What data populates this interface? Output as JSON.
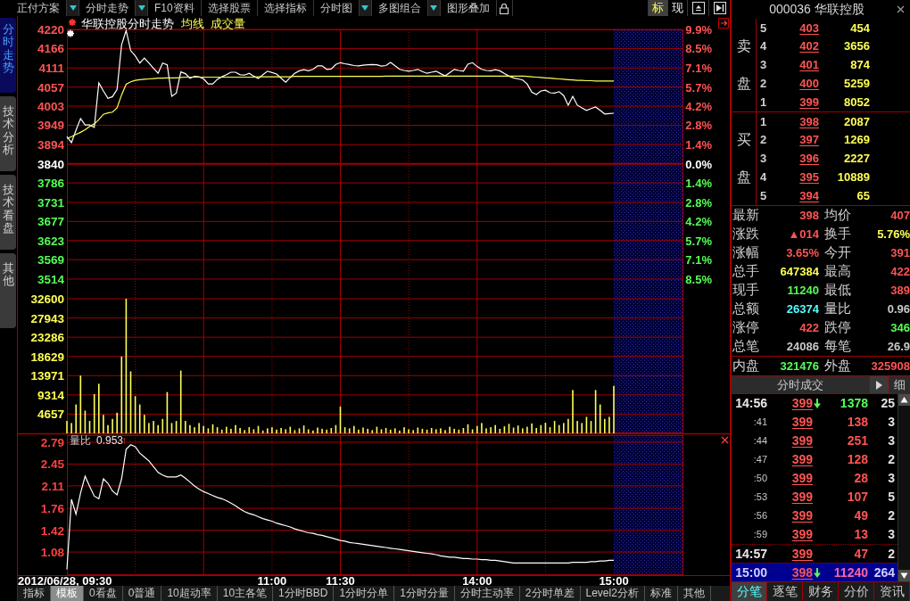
{
  "toolbar": {
    "menus": [
      {
        "label": "正付方案",
        "dropdown": true
      },
      {
        "label": "分时走势",
        "dropdown": true
      },
      {
        "label": "F10资料",
        "dropdown": false
      },
      {
        "label": "选择股票",
        "dropdown": false
      },
      {
        "label": "选择指标",
        "dropdown": false
      },
      {
        "label": "分时图",
        "dropdown": true
      },
      {
        "label": "多图组合",
        "dropdown": true
      },
      {
        "label": "图形叠加",
        "dropdown": false
      }
    ],
    "view_tabs": [
      {
        "label": "标",
        "selected": true
      },
      {
        "label": "现",
        "selected": false
      }
    ]
  },
  "side_tabs": [
    {
      "label": "分时走势",
      "selected": true
    },
    {
      "label": "技术分析",
      "selected": false
    },
    {
      "label": "技术看盘",
      "selected": false
    },
    {
      "label": "其他",
      "selected": false
    }
  ],
  "chart": {
    "price_panel": {
      "chart_data": {
        "type": "line",
        "title": "华联控股分时走势",
        "categories": [
          null,
          null,
          null,
          null,
          null,
          null,
          null,
          null,
          null,
          null,
          null,
          null,
          null,
          null,
          null,
          null,
          null,
          null,
          null,
          null,
          null,
          null,
          null,
          null,
          null,
          null,
          null,
          null,
          null,
          null,
          null,
          null,
          null,
          null,
          null,
          null,
          null,
          null,
          null,
          null,
          null,
          null,
          null,
          null,
          null,
          null,
          null,
          null,
          null,
          null,
          null,
          null,
          null,
          null,
          null,
          null,
          null,
          null,
          null,
          null,
          null,
          null,
          null,
          null,
          null,
          null,
          null,
          null,
          null,
          null,
          null,
          null,
          null,
          null,
          null,
          null,
          null,
          null,
          null,
          null,
          null,
          null,
          null,
          null,
          null,
          null,
          null,
          null,
          null,
          null,
          null,
          null,
          null,
          null,
          null,
          null,
          null,
          null,
          null,
          null,
          null,
          null,
          null,
          null,
          null,
          null,
          null,
          null,
          null,
          null,
          null,
          null,
          null,
          null,
          null,
          null,
          null,
          null,
          null,
          null,
          null
        ],
        "series": [
          {
            "color": "#ffffff",
            "values": [
              3917,
              3900,
              3935,
              3968,
              3950,
              3950,
              3943,
              4069,
              4046,
              4025,
              4030,
              4050,
              4177,
              4217,
              4160,
              4145,
              4125,
              4139,
              4125,
              4110,
              4096,
              4125,
              4120,
              4031,
              4040,
              4100,
              4095,
              4082,
              4087,
              4086,
              4080,
              4066,
              4066,
              4079,
              4086,
              4092,
              4099,
              4099,
              4092,
              4091,
              4096,
              4088,
              4081,
              4092,
              4102,
              4098,
              4094,
              4082,
              4071,
              4084,
              4096,
              4103,
              4106,
              4103,
              4107,
              4117,
              4117,
              4107,
              4108,
              4121,
              4126,
              4123,
              4121,
              4118,
              4117,
              4119,
              4120,
              4121,
              4120,
              4116,
              4118,
              4127,
              4117,
              4107,
              4104,
              4102,
              4104,
              4107,
              4101,
              4096,
              4099,
              4102,
              4095,
              4089,
              4098,
              4107,
              4104,
              4102,
              4122,
              4126,
              4115,
              4107,
              4104,
              4103,
              4106,
              4103,
              4095,
              4088,
              4083,
              4080,
              4077,
              4066,
              4043,
              4036,
              4046,
              4048,
              4041,
              4040,
              4044,
              4033,
              4006,
              4031,
              4006,
              3998,
              3991,
              3996,
              4001,
              3991,
              3981,
              3982,
              3983
            ]
          },
          {
            "name": "均线",
            "color": "#ffff54",
            "values": [
              3912,
              3917,
              3923,
              3929,
              3936,
              3946,
              3953,
              3965,
              3980,
              3984,
              3986,
              3998,
              4035,
              4065,
              4072,
              4076,
              4078,
              4079,
              4080,
              4081,
              4082,
              4082,
              4083,
              4083,
              4083,
              4084,
              4085,
              4085,
              4085,
              4085,
              4085,
              4085,
              4085,
              4085,
              4085,
              4085,
              4085,
              4085,
              4085,
              4085,
              4085,
              4085,
              4086,
              4086,
              4086,
              4086,
              4086,
              4086,
              4086,
              4086,
              4087,
              4087,
              4087,
              4087,
              4087,
              4087,
              4087,
              4087,
              4087,
              4087,
              4087,
              4087,
              4087,
              4087,
              4087,
              4087,
              4087,
              4087,
              4087,
              4087,
              4088,
              4088,
              4088,
              4088,
              4088,
              4088,
              4088,
              4088,
              4088,
              4088,
              4088,
              4088,
              4088,
              4088,
              4088,
              4088,
              4088,
              4088,
              4088,
              4088,
              4088,
              4088,
              4088,
              4088,
              4088,
              4088,
              4088,
              4088,
              4088,
              4088,
              4088,
              4087,
              4086,
              4085,
              4084,
              4083,
              4082,
              4081,
              4080,
              4079,
              4078,
              4077,
              4076,
              4076,
              4075,
              4075,
              4074,
              4074,
              4074,
              4074,
              4074
            ]
          }
        ],
        "ylim": [
          3514,
          4220
        ],
        "yticks": [
          4220,
          4166,
          4111,
          4057,
          4003,
          3949,
          3894,
          3840,
          3786,
          3731,
          3677,
          3623,
          3569,
          3514
        ]
      },
      "right_axis": [
        {
          "label": "9.9%",
          "kind": "up"
        },
        {
          "label": "8.5%",
          "kind": "up"
        },
        {
          "label": "7.1%",
          "kind": "up"
        },
        {
          "label": "5.7%",
          "kind": "up"
        },
        {
          "label": "4.2%",
          "kind": "up"
        },
        {
          "label": "2.8%",
          "kind": "up"
        },
        {
          "label": "1.4%",
          "kind": "up"
        },
        {
          "label": "0.0%",
          "kind": "flat"
        },
        {
          "label": "1.4%",
          "kind": "down"
        },
        {
          "label": "2.8%",
          "kind": "down"
        },
        {
          "label": "4.2%",
          "kind": "down"
        },
        {
          "label": "5.7%",
          "kind": "down"
        },
        {
          "label": "7.1%",
          "kind": "down"
        },
        {
          "label": "8.5%",
          "kind": "down"
        }
      ]
    },
    "volume_panel": {
      "chart_data": {
        "type": "bar",
        "categories": [
          null,
          null,
          null,
          null,
          null,
          null,
          null,
          null,
          null,
          null,
          null,
          null,
          null,
          null,
          null,
          null,
          null,
          null,
          null,
          null,
          null,
          null,
          null,
          null,
          null,
          null,
          null,
          null,
          null,
          null,
          null,
          null,
          null,
          null,
          null,
          null,
          null,
          null,
          null,
          null,
          null,
          null,
          null,
          null,
          null,
          null,
          null,
          null,
          null,
          null,
          null,
          null,
          null,
          null,
          null,
          null,
          null,
          null,
          null,
          null,
          null,
          null,
          null,
          null,
          null,
          null,
          null,
          null,
          null,
          null,
          null,
          null,
          null,
          null,
          null,
          null,
          null,
          null,
          null,
          null,
          null,
          null,
          null,
          null,
          null,
          null,
          null,
          null,
          null,
          null,
          null,
          null,
          null,
          null,
          null,
          null,
          null,
          null,
          null,
          null,
          null,
          null,
          null,
          null,
          null,
          null,
          null,
          null,
          null,
          null,
          null,
          null,
          null,
          null,
          null,
          null,
          null,
          null,
          null,
          null,
          null
        ],
        "series": [
          {
            "name": "成交量",
            "color": "#ffff54",
            "values": [
              3000,
              2500,
              7000,
              14000,
              5500,
              3000,
              9500,
              12000,
              4500,
              2000,
              3500,
              5000,
              18600,
              32600,
              15000,
              9000,
              7000,
              4500,
              2500,
              3000,
              2000,
              3500,
              10000,
              2500,
              3000,
              15200,
              3000,
              2000,
              1500,
              2500,
              1800,
              1200,
              2200,
              1500,
              900,
              1600,
              1100,
              2000,
              1300,
              800,
              1500,
              1000,
              1800,
              700,
              1200,
              1500,
              900,
              1300,
              1000,
              1600,
              800,
              1200,
              1900,
              1000,
              700,
              1400,
              1100,
              900,
              1300,
              2000,
              6500,
              1500,
              1200,
              1800,
              900,
              1400,
              1100,
              800,
              1600,
              1000,
              1300,
              900,
              1200,
              700,
              1500,
              1000,
              800,
              1400,
              1100,
              900,
              1300,
              1000,
              1200,
              800,
              1600,
              1100,
              900,
              1300,
              2200,
              1000,
              1800,
              2500,
              1200,
              1500,
              2000,
              1100,
              1700,
              2300,
              1400,
              1900,
              1200,
              1600,
              2400,
              1300,
              2000,
              2600,
              1500,
              3000,
              2000,
              2500,
              3500,
              10500,
              3000,
              2500,
              4000,
              3000,
              10500,
              7000,
              3500,
              4000,
              11500
            ]
          }
        ],
        "ylim": [
          0,
          32600
        ],
        "yticks": [
          32600,
          27943,
          23286,
          18629,
          13971,
          9314,
          4657
        ]
      }
    },
    "ratio_panel": {
      "reading": "0.953",
      "arrow": "↑",
      "chart_data": {
        "type": "line",
        "categories": [
          "2012/06/28, 09:30",
          null,
          null,
          null,
          null,
          null,
          null,
          null,
          null,
          null,
          null,
          null,
          null,
          null,
          null,
          null,
          null,
          null,
          null,
          null,
          null,
          null,
          null,
          null,
          null,
          null,
          null,
          null,
          null,
          null,
          null,
          null,
          null,
          null,
          null,
          null,
          null,
          null,
          null,
          null,
          null,
          null,
          null,
          null,
          null,
          "11:00",
          null,
          null,
          null,
          null,
          null,
          null,
          null,
          null,
          null,
          null,
          null,
          null,
          null,
          null,
          "11:30",
          null,
          null,
          null,
          null,
          null,
          null,
          null,
          null,
          null,
          null,
          null,
          null,
          null,
          null,
          null,
          null,
          null,
          null,
          null,
          null,
          null,
          null,
          null,
          null,
          null,
          null,
          null,
          null,
          null,
          "14:00",
          null,
          null,
          null,
          null,
          null,
          null,
          null,
          null,
          null,
          null,
          null,
          null,
          null,
          null,
          null,
          null,
          null,
          null,
          null,
          null,
          null,
          null,
          null,
          null,
          null,
          null,
          null,
          null,
          null,
          "15:00"
        ],
        "series": [
          {
            "name": "量比",
            "color": "#ffffff",
            "values": [
              0.81,
              1.9,
              1.67,
              2,
              2.26,
              2.1,
              1.95,
              1.91,
              2.22,
              2.15,
              2.03,
              1.97,
              2.22,
              2.68,
              2.75,
              2.72,
              2.62,
              2.56,
              2.5,
              2.41,
              2.32,
              2.28,
              2.25,
              2.25,
              2.25,
              2.28,
              2.23,
              2.17,
              2.11,
              2.06,
              2.02,
              1.99,
              1.96,
              1.93,
              1.91,
              1.88,
              1.84,
              1.8,
              1.75,
              1.71,
              1.68,
              1.66,
              1.63,
              1.6,
              1.58,
              1.56,
              1.53,
              1.51,
              1.49,
              1.47,
              1.44,
              1.42,
              1.4,
              1.38,
              1.37,
              1.35,
              1.34,
              1.32,
              1.3,
              1.28,
              1.26,
              1.25,
              1.23,
              1.22,
              1.21,
              1.2,
              1.19,
              1.18,
              1.17,
              1.16,
              1.15,
              1.14,
              1.13,
              1.12,
              1.11,
              1.1,
              1.09,
              1.08,
              1.07,
              1.06,
              1.05,
              1.04,
              1.02,
              1.01,
              1,
              1,
              0.99,
              0.98,
              0.98,
              0.97,
              0.97,
              0.96,
              0.96,
              0.95,
              0.95,
              0.94,
              0.93,
              0.92,
              0.91,
              0.91,
              0.91,
              0.91,
              0.91,
              0.91,
              0.91,
              0.91,
              0.91,
              0.91,
              0.91,
              0.91,
              0.91,
              0.92,
              0.92,
              0.92,
              0.92,
              0.93,
              0.93,
              0.94,
              0.94,
              0.95,
              0.95
            ]
          }
        ],
        "ylim": [
          0.72,
          2.9
        ],
        "yticks": [
          2.79,
          2.45,
          2.11,
          1.76,
          1.42,
          1.08
        ]
      }
    }
  },
  "bottom_tabs": [
    {
      "label": "指标",
      "selected": false
    },
    {
      "label": "模板",
      "selected": true
    },
    {
      "label": "0看盘",
      "selected": false
    },
    {
      "label": "0普通",
      "selected": false
    },
    {
      "label": "10超动率",
      "selected": false
    },
    {
      "label": "10主各笔",
      "selected": false
    },
    {
      "label": "1分时BBD",
      "selected": false
    },
    {
      "label": "1分时分单",
      "selected": false
    },
    {
      "label": "1分时分量",
      "selected": false
    },
    {
      "label": "分时主动率",
      "selected": false
    },
    {
      "label": "2分时单差",
      "selected": false
    },
    {
      "label": "Level2分析",
      "selected": false
    },
    {
      "label": "标准",
      "selected": false
    },
    {
      "label": "其他",
      "selected": false
    }
  ],
  "quote": {
    "title": "000036 华联控股",
    "sell_label": "卖盘",
    "sell": [
      {
        "rank": "5",
        "price": "403",
        "volume": "454"
      },
      {
        "rank": "4",
        "price": "402",
        "volume": "3656"
      },
      {
        "rank": "3",
        "price": "401",
        "volume": "874"
      },
      {
        "rank": "2",
        "price": "400",
        "volume": "5259"
      },
      {
        "rank": "1",
        "price": "399",
        "volume": "8052"
      }
    ],
    "buy_label": "买盘",
    "buy": [
      {
        "rank": "1",
        "price": "398",
        "volume": "2087"
      },
      {
        "rank": "2",
        "price": "397",
        "volume": "1269"
      },
      {
        "rank": "3",
        "price": "396",
        "volume": "2227"
      },
      {
        "rank": "4",
        "price": "395",
        "volume": "10889"
      },
      {
        "rank": "5",
        "price": "394",
        "volume": "65"
      }
    ],
    "stats": [
      {
        "label": "最新",
        "value": "398",
        "color": "#ff5454"
      },
      {
        "label": "均价",
        "value": "407",
        "color": "#ff5454"
      },
      {
        "label": "涨跌",
        "value": "▲014",
        "color": "#ff5454"
      },
      {
        "label": "换手",
        "value": "5.76%",
        "color": "#ffff54"
      },
      {
        "label": "涨幅",
        "value": "3.65%",
        "color": "#ff5454"
      },
      {
        "label": "今开",
        "value": "391",
        "color": "#ff5454"
      },
      {
        "label": "总手",
        "value": "647384",
        "color": "#ffff54"
      },
      {
        "label": "最高",
        "value": "422",
        "color": "#ff5454"
      },
      {
        "label": "现手",
        "value": "11240",
        "color": "#54ff54"
      },
      {
        "label": "最低",
        "value": "389",
        "color": "#ff5454"
      },
      {
        "label": "总额",
        "value": "26374",
        "color": "#54ffff"
      },
      {
        "label": "量比",
        "value": "0.96",
        "color": "#c8c8c8"
      },
      {
        "label": "涨停",
        "value": "422",
        "color": "#ff5454"
      },
      {
        "label": "跌停",
        "value": "346",
        "color": "#54ff54"
      },
      {
        "label": "总笔",
        "value": "24086",
        "color": "#c8c8c8"
      },
      {
        "label": "每笔",
        "value": "26.9",
        "color": "#c8c8c8"
      }
    ],
    "inner_outer": [
      {
        "label": "内盘",
        "value": "321476",
        "color": "#54ff54"
      },
      {
        "label": "外盘",
        "value": "325908",
        "color": "#ff5454"
      }
    ]
  },
  "trades": {
    "title": "分时成交",
    "detail_label": "细",
    "rows": [
      {
        "time": "14:56",
        "kind": "minute",
        "price": "399",
        "down_arrow": true,
        "volume": "1378",
        "sell": true,
        "count": "25",
        "selected": false
      },
      {
        "time": ":41",
        "kind": "second",
        "price": "399",
        "down_arrow": false,
        "volume": "138",
        "sell": false,
        "count": "3",
        "selected": false
      },
      {
        "time": ":44",
        "kind": "second",
        "price": "399",
        "down_arrow": false,
        "volume": "251",
        "sell": false,
        "count": "3",
        "selected": false
      },
      {
        "time": ":47",
        "kind": "second",
        "price": "399",
        "down_arrow": false,
        "volume": "128",
        "sell": false,
        "count": "2",
        "selected": false
      },
      {
        "time": ":50",
        "kind": "second",
        "price": "399",
        "down_arrow": false,
        "volume": "28",
        "sell": false,
        "count": "3",
        "selected": false
      },
      {
        "time": ":53",
        "kind": "second",
        "price": "399",
        "down_arrow": false,
        "volume": "107",
        "sell": false,
        "count": "5",
        "selected": false
      },
      {
        "time": ":56",
        "kind": "second",
        "price": "399",
        "down_arrow": false,
        "volume": "49",
        "sell": false,
        "count": "2",
        "selected": false
      },
      {
        "time": ":59",
        "kind": "second",
        "price": "399",
        "down_arrow": false,
        "volume": "13",
        "sell": false,
        "count": "3",
        "selected": false
      },
      {
        "time": "14:57",
        "kind": "minute",
        "price": "399",
        "down_arrow": false,
        "volume": "47",
        "sell": false,
        "count": "2",
        "selected": false
      },
      {
        "time": "15:00",
        "kind": "minute",
        "price": "398",
        "down_arrow": true,
        "volume": "11240",
        "sell": false,
        "count": "264",
        "selected": true
      }
    ],
    "tabs": [
      {
        "label": "分笔",
        "selected": true
      },
      {
        "label": "逐笔",
        "selected": false
      },
      {
        "label": "财务",
        "selected": false
      },
      {
        "label": "分价",
        "selected": false
      },
      {
        "label": "资讯",
        "selected": false
      }
    ]
  }
}
